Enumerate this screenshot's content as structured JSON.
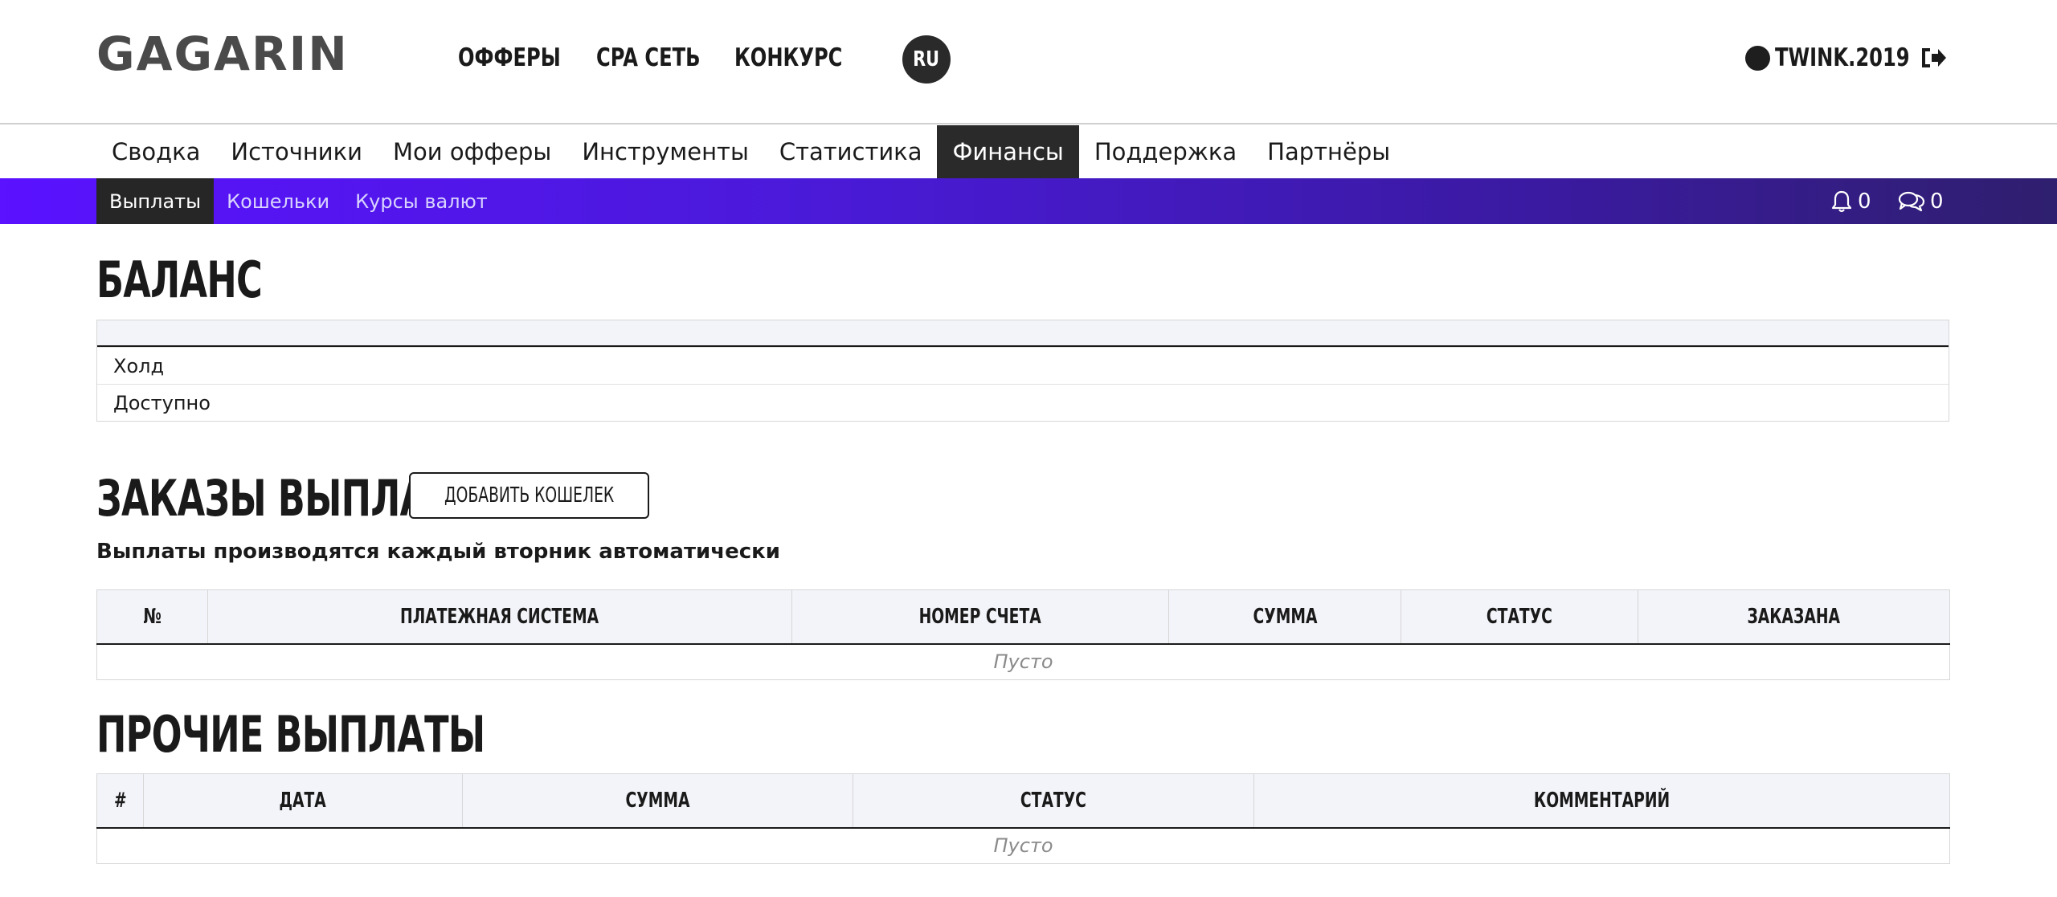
{
  "header": {
    "logo": "GAGARIN",
    "top_links": [
      "ОФФЕРЫ",
      "CPA СЕТЬ",
      "КОНКУРС"
    ],
    "language": "RU",
    "username": "TWINK.2019"
  },
  "main_nav": {
    "items": [
      "Сводка",
      "Источники",
      "Мои офферы",
      "Инструменты",
      "Статистика",
      "Финансы",
      "Поддержка",
      "Партнёры"
    ],
    "active": "Финансы"
  },
  "sub_nav": {
    "items": [
      "Выплаты",
      "Кошельки",
      "Курсы валют"
    ],
    "active": "Выплаты",
    "notifications_count": "0",
    "messages_count": "0"
  },
  "balance": {
    "title": "БАЛАНС",
    "rows": [
      "Холд",
      "Доступно"
    ]
  },
  "payout_orders": {
    "title": "ЗАКАЗЫ ВЫПЛАТ",
    "add_wallet_label": "ДОБАВИТЬ КОШЕЛЕК",
    "note": "Выплаты производятся каждый вторник автоматически",
    "columns": [
      "№",
      "ПЛАТЕЖНАЯ СИСТЕМА",
      "НОМЕР СЧЕТА",
      "СУММА",
      "СТАТУС",
      "ЗАКАЗАНА"
    ],
    "empty_text": "Пусто"
  },
  "other_payouts": {
    "title": "ПРОЧИЕ ВЫПЛАТЫ",
    "columns": [
      "#",
      "ДАТА",
      "СУММА",
      "СТАТУС",
      "КОММЕНТАРИЙ"
    ],
    "empty_text": "Пусто"
  },
  "colors": {
    "accent_gradient_start": "#5a12ff",
    "accent_gradient_end": "#2f1f6e",
    "active_tab": "#2a2a2a"
  }
}
